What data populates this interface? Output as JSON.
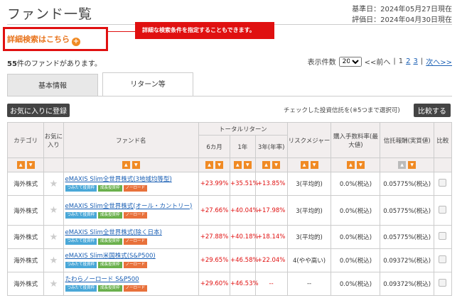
{
  "page": {
    "title": "ファンド一覧",
    "base_date": "基準日：2024年05月27日現在",
    "eval_date": "評価日：2024年04月30日現在"
  },
  "search": {
    "detail_link": "詳細検索はこちら",
    "callout": "詳細な検索条件を指定することもできます。"
  },
  "summary": {
    "count": "55",
    "count_suffix": "件のファンドがあります。"
  },
  "pager": {
    "label": "表示件数",
    "per_page": "20",
    "prev": "<<前へ",
    "sep": "|",
    "p1": "1",
    "p2": "2",
    "p3": "3",
    "next": "次へ>>"
  },
  "tabs": [
    {
      "label": "基本情報"
    },
    {
      "label": "リターン等"
    }
  ],
  "toolbar": {
    "fav_button": "お気に入りに登録",
    "compare_note": "チェックした投資信託を(※5つまで選択可)",
    "compare_button": "比較する"
  },
  "columns": {
    "category": "カテゴリ",
    "favorite": "お気に入り",
    "fund_name": "ファンド名",
    "total_return": "トータルリターン",
    "m6": "6カ月",
    "y1": "1年",
    "y3": "3年(年率)",
    "risk": "リスクメジャー",
    "fee": "購入手数料率(最大値)",
    "trust": "信託報酬(実質値)",
    "compare": "比較"
  },
  "icons": {
    "star": "star-icon",
    "sort_up": "sort-asc-icon",
    "sort_down": "sort-desc-icon",
    "plus": "plus-circle-icon"
  },
  "colors": {
    "accent": "#f08a24",
    "highlight": "#e01010",
    "link": "#1a5fb4",
    "tag_tsumitate": "#4aa8d8",
    "tag_seicho": "#6ab04c",
    "tag_noload": "#e8713b"
  },
  "rows": [
    {
      "category": "海外株式",
      "name": "eMAXIS Slim全世界株式(3地域均等型)",
      "tags": [
        "つみたて投資枠",
        "成長投資枠",
        "ノーロード"
      ],
      "m6": "+23.99%",
      "y1": "+35.51%",
      "y3": "+13.85%",
      "risk": "3(平均的)",
      "fee": "0.0%(税込)",
      "trust": "0.05775%(税込)"
    },
    {
      "category": "海外株式",
      "name": "eMAXIS Slim全世界株式(オール・カントリー)",
      "tags": [
        "つみたて投資枠",
        "成長投資枠",
        "ノーロード"
      ],
      "m6": "+27.66%",
      "y1": "+40.04%",
      "y3": "+17.98%",
      "risk": "3(平均的)",
      "fee": "0.0%(税込)",
      "trust": "0.05775%(税込)"
    },
    {
      "category": "海外株式",
      "name": "eMAXIS Slim全世界株式(除く日本)",
      "tags": [
        "つみたて投資枠",
        "成長投資枠",
        "ノーロード"
      ],
      "m6": "+27.88%",
      "y1": "+40.18%",
      "y3": "+18.14%",
      "risk": "3(平均的)",
      "fee": "0.0%(税込)",
      "trust": "0.05775%(税込)"
    },
    {
      "category": "海外株式",
      "name": "eMAXIS Slim米国株式(S&P500)",
      "tags": [
        "つみたて投資枠",
        "成長投資枠",
        "ノーロード"
      ],
      "m6": "+29.65%",
      "y1": "+46.58%",
      "y3": "+22.04%",
      "risk": "4(やや高い)",
      "fee": "0.0%(税込)",
      "trust": "0.09372%(税込)"
    },
    {
      "category": "海外株式",
      "name": "たわらノーロード S&P500",
      "tags": [
        "つみたて投資枠",
        "成長投資枠",
        "ノーロード"
      ],
      "m6": "+29.60%",
      "y1": "+46.53%",
      "y3": "--",
      "risk": "--",
      "fee": "0.0%(税込)",
      "trust": "0.09372%(税込)"
    }
  ]
}
